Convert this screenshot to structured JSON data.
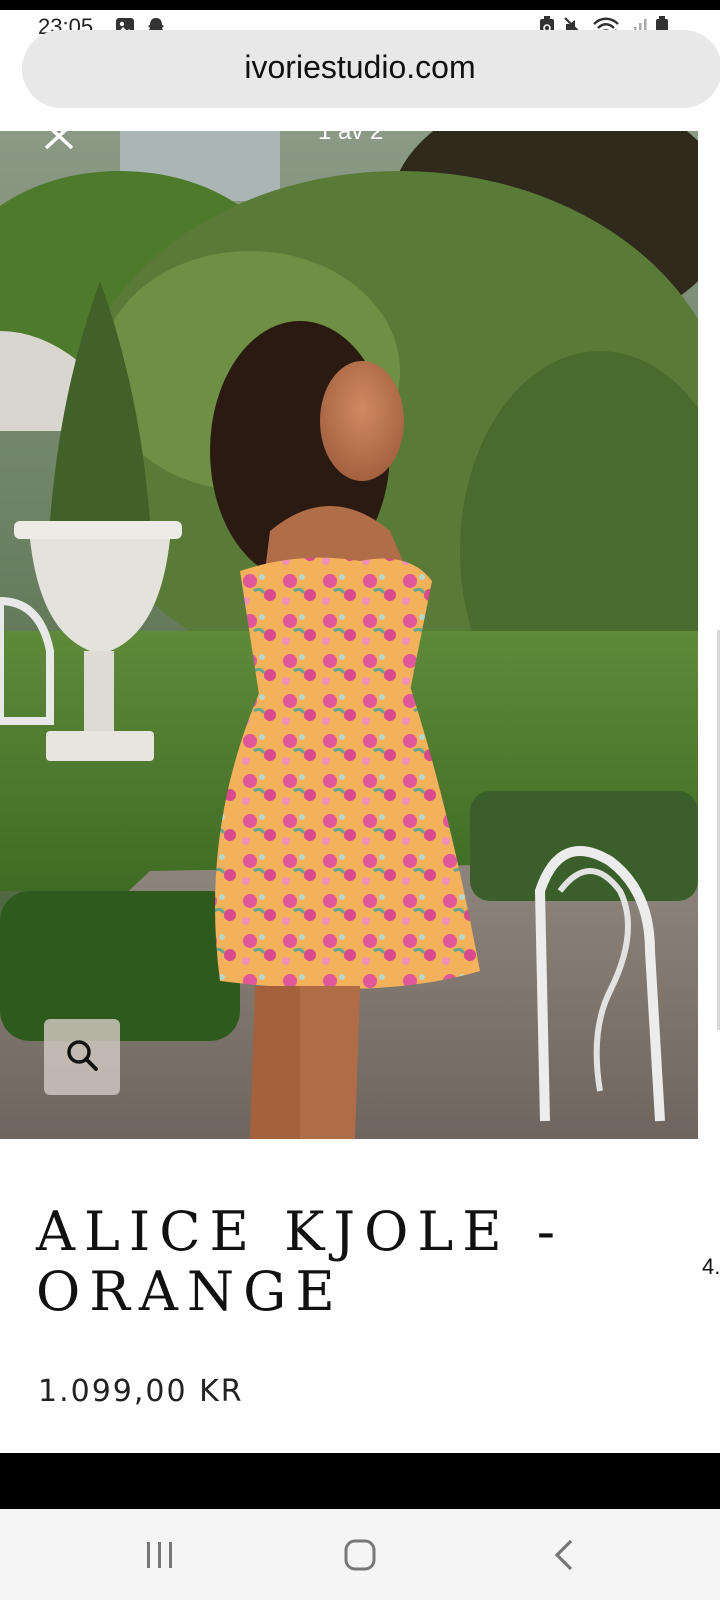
{
  "status_bar": {
    "time": "23:05",
    "left_icons": [
      "image-icon",
      "snapchat-icon"
    ],
    "right_icons": [
      "battery-saver-icon",
      "mute-icon",
      "wifi-icon",
      "signal-icon",
      "battery-icon"
    ]
  },
  "browser": {
    "url": "ivoriestudio.com"
  },
  "gallery": {
    "counter": "1 av 2",
    "close_icon": "close-icon",
    "zoom_icon": "search-icon"
  },
  "product": {
    "title": "ALICE KJOLE - ORANGE",
    "price": "1.099,00 KR",
    "side_peek": "4."
  },
  "nav": {
    "items": [
      "recent-apps-icon",
      "home-icon",
      "back-icon"
    ]
  },
  "colors": {
    "url_bar": "#e8e8e8",
    "nav_bg": "#f5f5f5",
    "text": "#111111"
  }
}
